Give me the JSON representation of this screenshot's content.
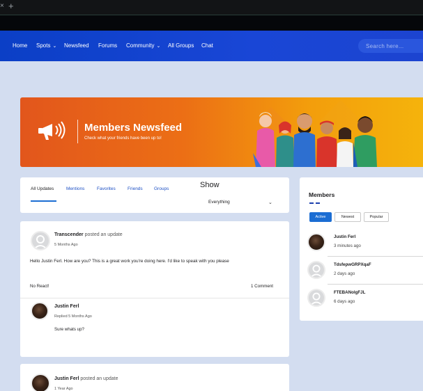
{
  "browser": {
    "close_glyph": "×",
    "new_tab_glyph": "+"
  },
  "nav": {
    "items": [
      {
        "label": "Home",
        "dropdown": false
      },
      {
        "label": "Spots",
        "dropdown": true
      },
      {
        "label": "Newsfeed",
        "dropdown": false
      },
      {
        "label": "Forums",
        "dropdown": false
      },
      {
        "label": "Community",
        "dropdown": true
      },
      {
        "label": "All Groups",
        "dropdown": false
      },
      {
        "label": "Chat",
        "dropdown": false
      }
    ],
    "chevron": "⌄",
    "search_placeholder": "Search here..."
  },
  "banner": {
    "title": "Members Newsfeed",
    "subtitle": "Check what your friends have been up to!",
    "icon": "megaphone-icon"
  },
  "feed_tabs": {
    "items": [
      "All Updates",
      "Mentions",
      "Favorites",
      "Friends",
      "Groups"
    ],
    "active_index": 0,
    "show_label": "Show",
    "show_value": "Everything",
    "chevron": "⌄"
  },
  "posts": [
    {
      "author": "Transcender",
      "action": "posted an update",
      "time": "5 Months Ago",
      "text": "Hello Justin Ferl. How are you? This is a great work you're doing here. I'd like to speak with you please",
      "react": "No React!",
      "comments": "1 Comment",
      "reply": {
        "author": "Justin Ferl",
        "time": "Replied 5 Months Ago",
        "text": "Sure whats up?"
      }
    },
    {
      "author": "Justin Ferl",
      "action": "posted an update",
      "time": "1 Year Ago"
    }
  ],
  "members": {
    "title": "Members",
    "filters": [
      "Active",
      "Newest",
      "Popular"
    ],
    "active_filter": "Active",
    "list": [
      {
        "name": "Justin Ferl",
        "time": "3 minutes ago",
        "avatar": "photo"
      },
      {
        "name": "TdsfepwGRPXqaF",
        "time": "2 days ago",
        "avatar": "default"
      },
      {
        "name": "FTEBANolgFJL",
        "time": "6 days ago",
        "avatar": "default"
      }
    ]
  },
  "colors": {
    "nav_bg": "#1946d6",
    "page_bg": "#d3ddf0",
    "accent": "#1b6dd3",
    "banner_start": "#e2561c",
    "banner_end": "#f5b50c"
  }
}
